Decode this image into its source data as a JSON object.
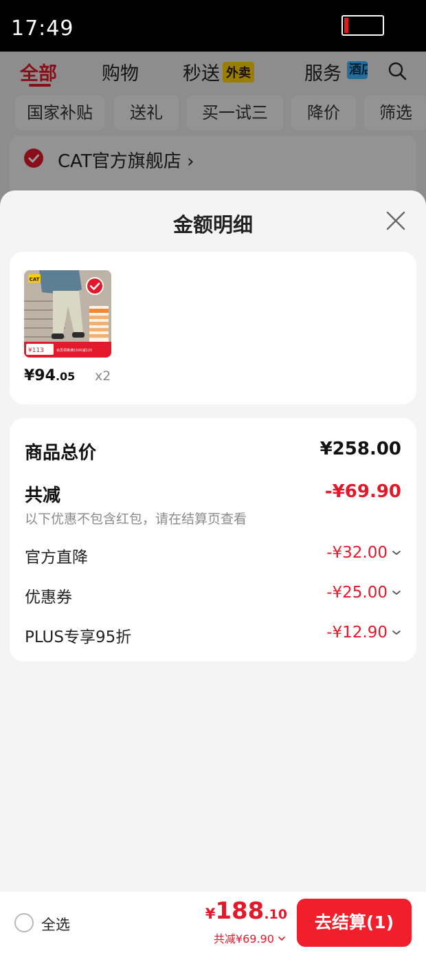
{
  "status_bar": {
    "time": "17:49",
    "battery_level": 0.12
  },
  "background": {
    "tabs": [
      {
        "label": "全部",
        "active": true
      },
      {
        "label": "购物"
      },
      {
        "label": "秒送",
        "tag": "外卖"
      },
      {
        "label": "服务",
        "tag": "酒店"
      }
    ],
    "chips": [
      "国家补贴",
      "送礼",
      "买一试三",
      "降价",
      "筛选"
    ],
    "store_name": "CAT官方旗舰店 ›"
  },
  "sheet": {
    "title": "金额明细",
    "product": {
      "price_int": "¥94",
      "price_dec": ".05",
      "quantity": "x2",
      "thumb_brand": "CAT",
      "thumb_price": "¥113",
      "thumb_banner": "会员领券满1500减120"
    },
    "summary": {
      "total_label": "商品总价",
      "total_value": "¥258.00",
      "discount_label": "共减",
      "discount_value": "-¥69.90",
      "discount_note": "以下优惠不包含红包，请在结算页查看",
      "items": [
        {
          "label": "官方直降",
          "value": "-¥32.00"
        },
        {
          "label": "优惠券",
          "value": "-¥25.00"
        },
        {
          "label": "PLUS专享95折",
          "value": "-¥12.90"
        }
      ]
    }
  },
  "bottom_bar": {
    "select_all": "全选",
    "currency": "¥",
    "total_int": "188",
    "total_dec": ".10",
    "total_discount": "共减¥69.90",
    "checkout_label": "去结算(1)"
  },
  "colors": {
    "accent": "#e3182b",
    "checkout": "#f01f2b"
  }
}
